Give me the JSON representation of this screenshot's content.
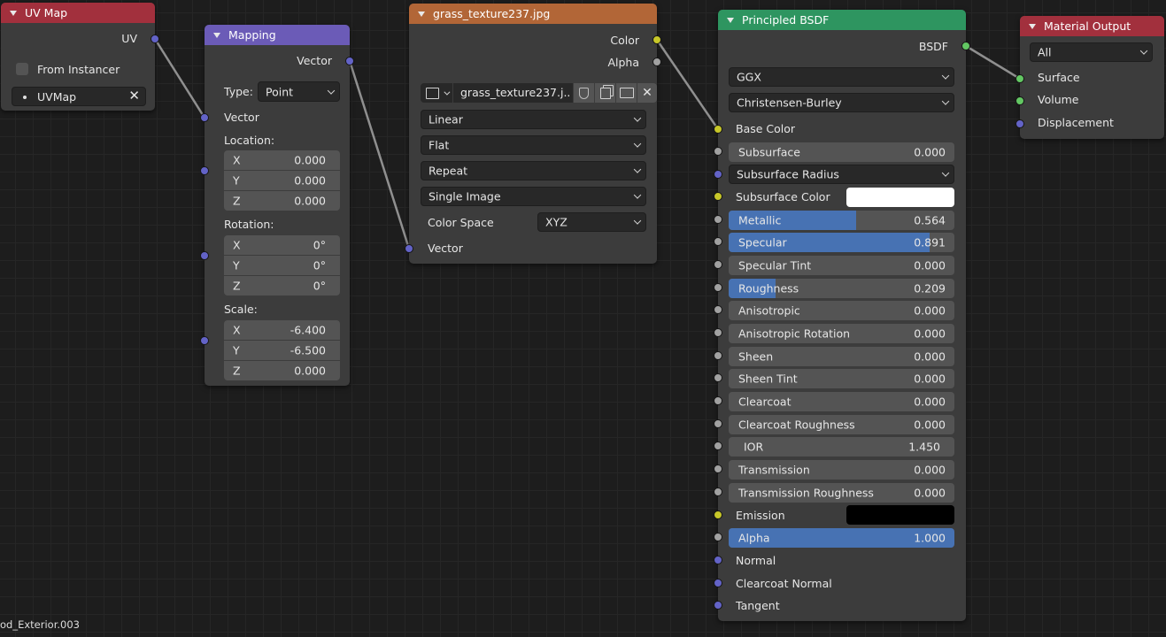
{
  "colors": {
    "uvmap_header": "#a2303d",
    "mapping_header": "#6b5bb7",
    "texture_header": "#b26637",
    "bsdf_header": "#2e9560",
    "output_header": "#a2303d",
    "socket_vector": "#6363c7",
    "socket_color": "#c7c729",
    "socket_float": "#a1a1a1",
    "socket_shader": "#63c763",
    "slider_fill": "#4772b3",
    "subsurface_color_swatch": "#ffffff",
    "emission_color_swatch": "#000000"
  },
  "uvmap": {
    "title": "UV Map",
    "output_uv": "UV",
    "from_instancer": "From Instancer",
    "from_instancer_checked": false,
    "uvmap_value": "UVMap"
  },
  "mapping": {
    "title": "Mapping",
    "output_vector": "Vector",
    "type_label": "Type:",
    "type_value": "Point",
    "input_vector": "Vector",
    "location_label": "Location:",
    "location": [
      {
        "axis": "X",
        "value": "0.000"
      },
      {
        "axis": "Y",
        "value": "0.000"
      },
      {
        "axis": "Z",
        "value": "0.000"
      }
    ],
    "rotation_label": "Rotation:",
    "rotation": [
      {
        "axis": "X",
        "value": "0°"
      },
      {
        "axis": "Y",
        "value": "0°"
      },
      {
        "axis": "Z",
        "value": "0°"
      }
    ],
    "scale_label": "Scale:",
    "scale": [
      {
        "axis": "X",
        "value": "-6.400"
      },
      {
        "axis": "Y",
        "value": "-6.500"
      },
      {
        "axis": "Z",
        "value": "0.000"
      }
    ]
  },
  "texture": {
    "title": "grass_texture237.jpg",
    "output_color": "Color",
    "output_alpha": "Alpha",
    "image_name": "grass_texture237.j..",
    "interpolation": "Linear",
    "projection": "Flat",
    "extension": "Repeat",
    "source": "Single Image",
    "color_space_label": "Color Space",
    "color_space_value": "XYZ",
    "input_vector": "Vector"
  },
  "bsdf": {
    "title": "Principled BSDF",
    "output_bsdf": "BSDF",
    "distribution": "GGX",
    "subsurface_method": "Christensen-Burley",
    "base_color": "Base Color",
    "subsurface": {
      "name": "Subsurface",
      "value": "0.000",
      "fraction": 0
    },
    "subsurface_radius": "Subsurface Radius",
    "subsurface_color": "Subsurface Color",
    "metallic": {
      "name": "Metallic",
      "value": "0.564",
      "fraction": 0.564
    },
    "specular": {
      "name": "Specular",
      "value": "0.891",
      "fraction": 0.891
    },
    "specular_tint": {
      "name": "Specular Tint",
      "value": "0.000",
      "fraction": 0
    },
    "roughness": {
      "name": "Roughness",
      "value": "0.209",
      "fraction": 0.209
    },
    "anisotropic": {
      "name": "Anisotropic",
      "value": "0.000",
      "fraction": 0
    },
    "anisotropic_rotation": {
      "name": "Anisotropic Rotation",
      "value": "0.000",
      "fraction": 0
    },
    "sheen": {
      "name": "Sheen",
      "value": "0.000",
      "fraction": 0
    },
    "sheen_tint": {
      "name": "Sheen Tint",
      "value": "0.000",
      "fraction": 0
    },
    "clearcoat": {
      "name": "Clearcoat",
      "value": "0.000",
      "fraction": 0
    },
    "clearcoat_roughness": {
      "name": "Clearcoat Roughness",
      "value": "0.000",
      "fraction": 0
    },
    "ior": {
      "name": "IOR",
      "value": "1.450"
    },
    "transmission": {
      "name": "Transmission",
      "value": "0.000",
      "fraction": 0
    },
    "transmission_roughness": {
      "name": "Transmission Roughness",
      "value": "0.000",
      "fraction": 0
    },
    "emission": "Emission",
    "alpha": {
      "name": "Alpha",
      "value": "1.000",
      "fraction": 1
    },
    "normal": "Normal",
    "clearcoat_normal": "Clearcoat Normal",
    "tangent": "Tangent"
  },
  "output": {
    "title": "Material Output",
    "target": "All",
    "surface": "Surface",
    "volume": "Volume",
    "displacement": "Displacement"
  },
  "footer": {
    "material_name": "od_Exterior.003"
  }
}
